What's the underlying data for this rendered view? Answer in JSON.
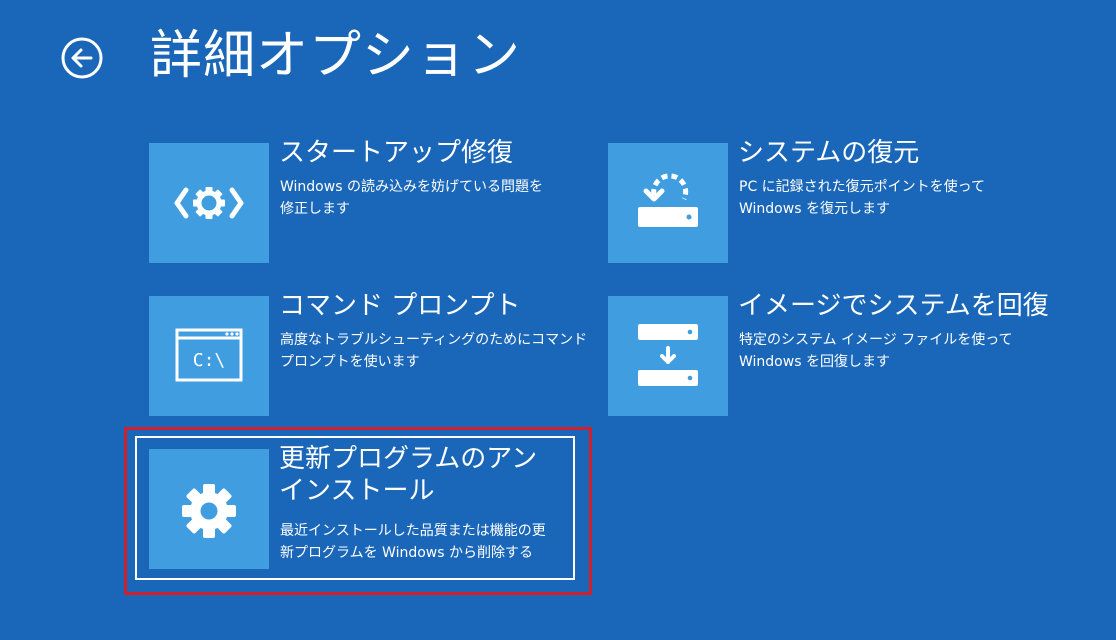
{
  "header": {
    "title": "詳細オプション"
  },
  "options": [
    {
      "id": "startup-repair",
      "title": "スタートアップ修復",
      "desc_lines": [
        "Windows の読み込みを妨げている問題を",
        "修正します"
      ],
      "icon": "startup-repair-icon"
    },
    {
      "id": "system-restore",
      "title": "システムの復元",
      "desc_lines": [
        "PC に記録された復元ポイントを使って",
        "Windows を復元します"
      ],
      "icon": "system-restore-icon"
    },
    {
      "id": "command-prompt",
      "title": "コマンド プロンプト",
      "desc_lines": [
        "高度なトラブルシューティングのためにコマンド",
        "プロンプトを使います"
      ],
      "icon": "command-prompt-icon",
      "icon_text": "C:\\"
    },
    {
      "id": "system-image-recovery",
      "title": "イメージでシステムを回復",
      "desc_lines": [
        "特定のシステム イメージ ファイルを使って",
        "Windows を回復します"
      ],
      "icon": "system-image-icon"
    },
    {
      "id": "uninstall-updates",
      "title": "更新プログラムのアンインストール",
      "desc_lines": [
        "最近インストールした品質または機能の更",
        "新プログラムを Windows から削除する"
      ],
      "icon": "gear-icon",
      "selected": true
    }
  ],
  "colors": {
    "background": "#1a67b9",
    "tile": "#3f9de0",
    "text": "#ffffff",
    "highlight": "#d0202b"
  }
}
